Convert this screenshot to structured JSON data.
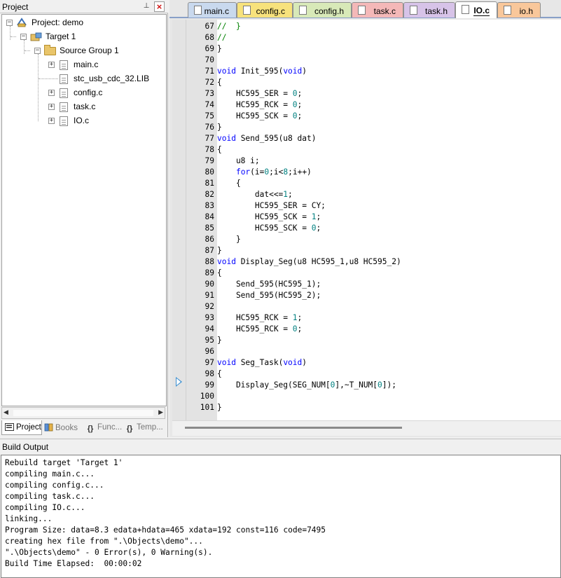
{
  "project_pane": {
    "title": "Project",
    "pin_glyph": "⊥",
    "close_glyph": "×",
    "tree": {
      "project_label": "Project: demo",
      "target_label": "Target 1",
      "group_label": "Source Group 1",
      "files": [
        "main.c",
        "stc_usb_cdc_32.LIB",
        "config.c",
        "task.c",
        "IO.c"
      ]
    },
    "bottom_tabs": [
      {
        "label": "Project",
        "icon": "project-icon",
        "active": true
      },
      {
        "label": "Books",
        "icon": "books-icon",
        "active": false
      },
      {
        "label": "Func...",
        "icon": "functions-icon",
        "active": false
      },
      {
        "label": "Temp...",
        "icon": "templates-icon",
        "active": false
      }
    ]
  },
  "editor": {
    "tabs": [
      {
        "label": "main.c",
        "color": "#c9d9ee",
        "active": false
      },
      {
        "label": "config.c",
        "color": "#f7e27c",
        "active": false
      },
      {
        "label": "config.h",
        "color": "#d8e9b8",
        "active": false
      },
      {
        "label": "task.c",
        "color": "#f4b8b8",
        "active": false
      },
      {
        "label": "task.h",
        "color": "#d7c3e8",
        "active": false
      },
      {
        "label": "IO.c",
        "color": "#ffffff",
        "active": true
      },
      {
        "label": "io.h",
        "color": "#f9c79a",
        "active": false
      }
    ],
    "lines": [
      {
        "n": "67",
        "code": "//  }"
      },
      {
        "n": "68",
        "code": "//"
      },
      {
        "n": "69",
        "code": "}"
      },
      {
        "n": "70",
        "code": ""
      },
      {
        "n": "71",
        "code": "void Init_595(void)"
      },
      {
        "n": "72",
        "code": "{"
      },
      {
        "n": "73",
        "code": "    HC595_SER = 0;"
      },
      {
        "n": "74",
        "code": "    HC595_RCK = 0;"
      },
      {
        "n": "75",
        "code": "    HC595_SCK = 0;"
      },
      {
        "n": "76",
        "code": "}"
      },
      {
        "n": "77",
        "code": "void Send_595(u8 dat)"
      },
      {
        "n": "78",
        "code": "{"
      },
      {
        "n": "79",
        "code": "    u8 i;"
      },
      {
        "n": "80",
        "code": "    for(i=0;i<8;i++)"
      },
      {
        "n": "81",
        "code": "    {"
      },
      {
        "n": "82",
        "code": "        dat<<=1;"
      },
      {
        "n": "83",
        "code": "        HC595_SER = CY;"
      },
      {
        "n": "84",
        "code": "        HC595_SCK = 1;"
      },
      {
        "n": "85",
        "code": "        HC595_SCK = 0;"
      },
      {
        "n": "86",
        "code": "    }"
      },
      {
        "n": "87",
        "code": "}"
      },
      {
        "n": "88",
        "code": "void Display_Seg(u8 HC595_1,u8 HC595_2)"
      },
      {
        "n": "89",
        "code": "{"
      },
      {
        "n": "90",
        "code": "    Send_595(HC595_1);"
      },
      {
        "n": "91",
        "code": "    Send_595(HC595_2);"
      },
      {
        "n": "92",
        "code": ""
      },
      {
        "n": "93",
        "code": "    HC595_RCK = 1;"
      },
      {
        "n": "94",
        "code": "    HC595_RCK = 0;"
      },
      {
        "n": "95",
        "code": "}"
      },
      {
        "n": "96",
        "code": ""
      },
      {
        "n": "97",
        "code": "void Seg_Task(void)"
      },
      {
        "n": "98",
        "code": "{"
      },
      {
        "n": "99",
        "code": "    Display_Seg(SEG_NUM[0],~T_NUM[0]);"
      },
      {
        "n": "100",
        "code": ""
      },
      {
        "n": "101",
        "code": "}"
      }
    ],
    "keyword_color": "#0000ff",
    "number_color": "#008080",
    "comment_color": "#008000"
  },
  "build_output": {
    "title": "Build Output",
    "lines": [
      "Rebuild target 'Target 1'",
      "compiling main.c...",
      "compiling config.c...",
      "compiling task.c...",
      "compiling IO.c...",
      "linking...",
      "Program Size: data=8.3 edata+hdata=465 xdata=192 const=116 code=7495",
      "creating hex file from \".\\Objects\\demo\"...",
      "\".\\Objects\\demo\" - 0 Error(s), 0 Warning(s).",
      "Build Time Elapsed:  00:00:02"
    ]
  }
}
